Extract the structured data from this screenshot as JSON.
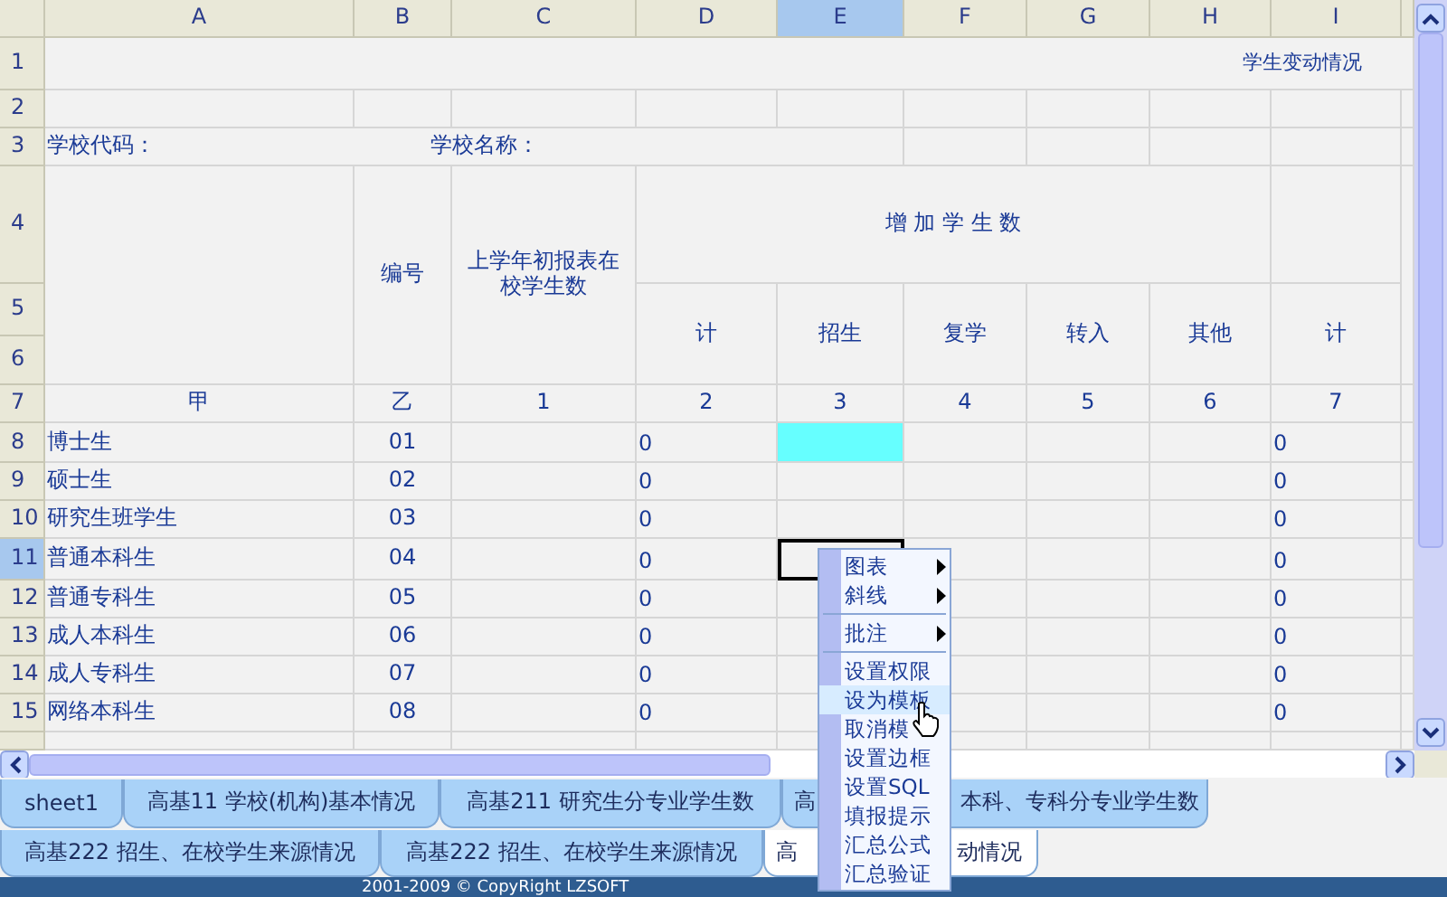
{
  "columns": [
    {
      "label": "A",
      "selected": false
    },
    {
      "label": "B",
      "selected": false
    },
    {
      "label": "C",
      "selected": false
    },
    {
      "label": "D",
      "selected": false
    },
    {
      "label": "E",
      "selected": true
    },
    {
      "label": "F",
      "selected": false
    },
    {
      "label": "G",
      "selected": false
    },
    {
      "label": "H",
      "selected": false
    },
    {
      "label": "I",
      "selected": false
    }
  ],
  "row_headers": [
    {
      "label": "1",
      "selected": false
    },
    {
      "label": "2",
      "selected": false
    },
    {
      "label": "3",
      "selected": false
    },
    {
      "label": "4",
      "selected": false
    },
    {
      "label": "5",
      "selected": false
    },
    {
      "label": "6",
      "selected": false
    },
    {
      "label": "7",
      "selected": false
    },
    {
      "label": "8",
      "selected": false
    },
    {
      "label": "9",
      "selected": false
    },
    {
      "label": "10",
      "selected": false
    },
    {
      "label": "11",
      "selected": true
    },
    {
      "label": "12",
      "selected": false
    },
    {
      "label": "13",
      "selected": false
    },
    {
      "label": "14",
      "selected": false
    },
    {
      "label": "15",
      "selected": false
    }
  ],
  "title": "学生变动情况",
  "school_code_label": "学校代码：",
  "school_name_label": "学校名称：",
  "header": {
    "code": "编号",
    "previous": "上学年初报表在校学生数",
    "increase": "增 加 学 生 数",
    "sub": [
      "计",
      "招生",
      "复学",
      "转入",
      "其他",
      "计"
    ]
  },
  "index_row": [
    "甲",
    "乙",
    "1",
    "2",
    "3",
    "4",
    "5",
    "6",
    "7"
  ],
  "data_rows": [
    {
      "name": "博士生",
      "code": "01",
      "col_d": "0",
      "col_i": "0",
      "e_highlighted": true,
      "e_selected": false
    },
    {
      "name": "硕士生",
      "code": "02",
      "col_d": "0",
      "col_i": "0",
      "e_highlighted": false,
      "e_selected": false
    },
    {
      "name": "研究生班学生",
      "code": "03",
      "col_d": "0",
      "col_i": "0",
      "e_highlighted": false,
      "e_selected": false
    },
    {
      "name": "普通本科生",
      "code": "04",
      "col_d": "0",
      "col_i": "0",
      "e_highlighted": false,
      "e_selected": true
    },
    {
      "name": "普通专科生",
      "code": "05",
      "col_d": "0",
      "col_i": "0",
      "e_highlighted": false,
      "e_selected": false
    },
    {
      "name": "成人本科生",
      "code": "06",
      "col_d": "0",
      "col_i": "0",
      "e_highlighted": false,
      "e_selected": false
    },
    {
      "name": "成人专科生",
      "code": "07",
      "col_d": "0",
      "col_i": "0",
      "e_highlighted": false,
      "e_selected": false
    },
    {
      "name": "网络本科生",
      "code": "08",
      "col_d": "0",
      "col_i": "0",
      "e_highlighted": false,
      "e_selected": false
    }
  ],
  "context_menu": {
    "items": [
      {
        "kind": "item",
        "label": "图表",
        "submenu": true,
        "selected": false
      },
      {
        "kind": "item",
        "label": "斜线",
        "submenu": true,
        "selected": false
      },
      {
        "kind": "separator"
      },
      {
        "kind": "item",
        "label": "批注",
        "submenu": true,
        "selected": false
      },
      {
        "kind": "separator"
      },
      {
        "kind": "item",
        "label": "设置权限",
        "submenu": false,
        "selected": false
      },
      {
        "kind": "item",
        "label": "设为模板",
        "submenu": false,
        "selected": true
      },
      {
        "kind": "item",
        "label": "取消模",
        "submenu": false,
        "selected": false
      },
      {
        "kind": "item",
        "label": "设置边框",
        "submenu": false,
        "selected": false
      },
      {
        "kind": "item",
        "label": "设置SQL",
        "submenu": false,
        "selected": false
      },
      {
        "kind": "item",
        "label": "填报提示",
        "submenu": false,
        "selected": false
      },
      {
        "kind": "item",
        "label": "汇总公式",
        "submenu": false,
        "selected": false
      },
      {
        "kind": "item",
        "label": "汇总验证",
        "submenu": false,
        "selected": false
      }
    ]
  },
  "sheet_tabs": [
    [
      {
        "parts": [
          "sheet1"
        ],
        "selected": false
      },
      {
        "parts": [
          "高基11 学校(机构)基本情况"
        ],
        "selected": false
      },
      {
        "parts": [
          "高基211 研究生分专业学生数"
        ],
        "selected": false
      },
      {
        "parts": [
          "高",
          "本科、专科分专业学生数"
        ],
        "selected": false
      }
    ],
    [
      {
        "parts": [
          "高基222 招生、在校学生来源情况"
        ],
        "selected": false
      },
      {
        "parts": [
          "高基222 招生、在校学生来源情况"
        ],
        "selected": false
      },
      {
        "parts": [
          "高",
          "动情况"
        ],
        "selected": true
      }
    ]
  ],
  "status_bar": "2001-2009 © CopyRight LZSOFT"
}
